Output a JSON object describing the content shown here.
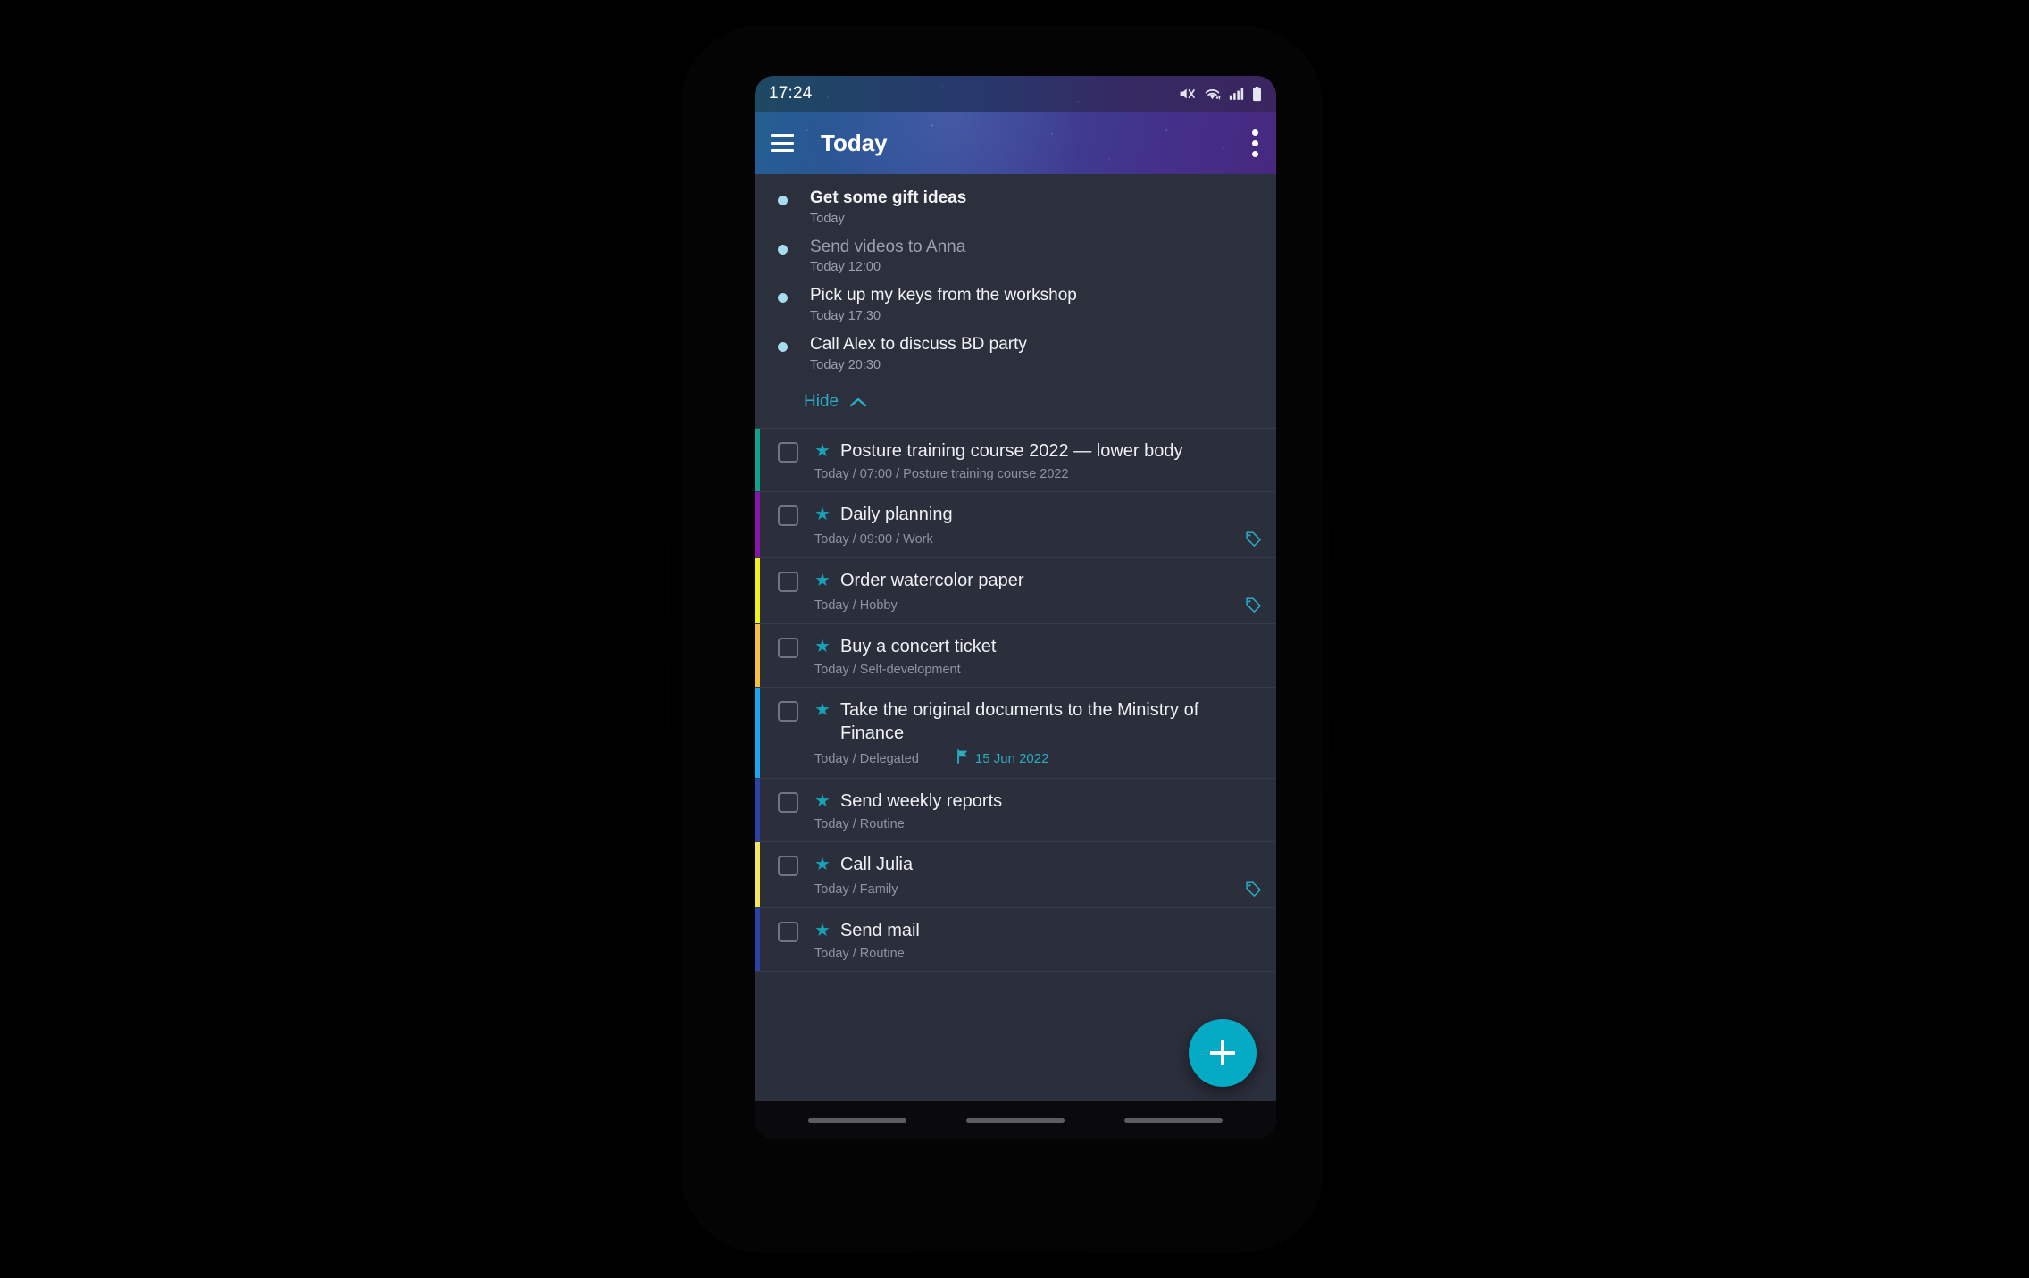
{
  "status_bar": {
    "time": "17:24",
    "icons": [
      "mute-icon",
      "wifi-icon",
      "signal-icon",
      "battery-icon"
    ]
  },
  "app_bar": {
    "menu_icon": "hamburger-menu-icon",
    "title": "Today",
    "overflow_icon": "overflow-menu-icon",
    "gradient_start": "#245f93",
    "gradient_end": "#46287f"
  },
  "overdue_section": {
    "items": [
      {
        "title": "Get some gift ideas",
        "sub": "Today",
        "bold": true,
        "dim": false
      },
      {
        "title": "Send videos to Anna",
        "sub": "Today 12:00",
        "bold": false,
        "dim": true
      },
      {
        "title": "Pick up my keys from the workshop",
        "sub": "Today 17:30",
        "bold": false,
        "dim": false
      },
      {
        "title": "Call Alex to discuss BD party",
        "sub": "Today 20:30",
        "bold": false,
        "dim": false
      }
    ],
    "hide_label": "Hide",
    "hide_icon": "chevron-up-icon",
    "bullet_color": "#a6dced"
  },
  "tasks": [
    {
      "title": "Posture training course 2022 — lower body",
      "sub": "Today / 07:00 / Posture training course 2022",
      "stripe": "#12a18b",
      "starred": true,
      "tag": false,
      "flag_date": null
    },
    {
      "title": "Daily planning",
      "sub": "Today / 09:00 / Work",
      "stripe": "#8b13b0",
      "starred": true,
      "tag": true,
      "flag_date": null
    },
    {
      "title": "Order watercolor paper",
      "sub": "Today / Hobby",
      "stripe": "#f3ef18",
      "starred": true,
      "tag": true,
      "flag_date": null
    },
    {
      "title": "Buy a concert ticket",
      "sub": "Today / Self-development",
      "stripe": "#f7c040",
      "starred": true,
      "tag": false,
      "flag_date": null
    },
    {
      "title": "Take the original documents to the Ministry of Finance",
      "sub": "Today / Delegated",
      "stripe": "#18a6ee",
      "starred": true,
      "tag": false,
      "flag_date": "15 Jun 2022"
    },
    {
      "title": "Send weekly reports",
      "sub": "Today / Routine",
      "stripe": "#2b41a8",
      "starred": true,
      "tag": false,
      "flag_date": null
    },
    {
      "title": "Call Julia",
      "sub": "Today / Family",
      "stripe": "#f3e75a",
      "starred": true,
      "tag": true,
      "flag_date": null
    },
    {
      "title": "Send mail",
      "sub": "Today / Routine",
      "stripe": "#2b41a8",
      "starred": true,
      "tag": false,
      "flag_date": null
    }
  ],
  "fab": {
    "icon": "plus-icon",
    "color": "#05ABC4"
  },
  "nav_bar": {
    "pills": [
      "recents-pill",
      "home-pill",
      "back-pill"
    ]
  },
  "theme": {
    "screen_bg": "#2b2e3b",
    "section_bg": "#2c2f3c",
    "accent": "#2aadc4",
    "star_color": "#17a2b8",
    "title_color": "#f0f1f4",
    "sub_color": "#8e94a4"
  }
}
